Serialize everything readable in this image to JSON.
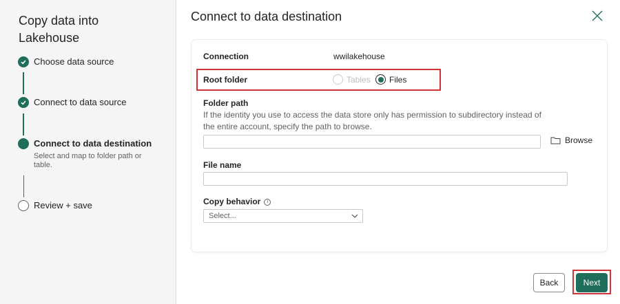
{
  "sidebar": {
    "title": "Copy data into Lakehouse",
    "steps": [
      {
        "label": "Choose data source",
        "state": "done"
      },
      {
        "label": "Connect to data source",
        "state": "done"
      },
      {
        "label": "Connect to data destination",
        "state": "current",
        "description": "Select and map to folder path or table."
      },
      {
        "label": "Review + save",
        "state": "todo"
      }
    ]
  },
  "header": {
    "title": "Connect to data destination"
  },
  "form": {
    "connection_label": "Connection",
    "connection_value": "wwilakehouse",
    "root_folder_label": "Root folder",
    "root_options": [
      {
        "label": "Tables",
        "checked": false,
        "disabled": true
      },
      {
        "label": "Files",
        "checked": true,
        "disabled": false
      }
    ],
    "folder_path_label": "Folder path",
    "folder_path_help": "If the identity you use to access the data store only has permission to subdirectory instead of the entire account, specify the path to browse.",
    "folder_path_value": "",
    "browse_label": "Browse",
    "file_name_label": "File name",
    "file_name_value": "",
    "copy_behavior_label": "Copy behavior",
    "copy_behavior_placeholder": "Select..."
  },
  "footer": {
    "back_label": "Back",
    "next_label": "Next"
  },
  "colors": {
    "accent": "#1f6e5a",
    "highlight": "#d13438"
  }
}
